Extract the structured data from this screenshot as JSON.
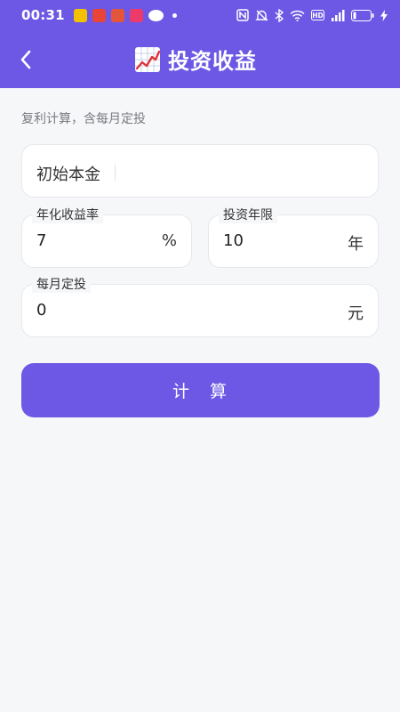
{
  "status_bar": {
    "time": "00:31",
    "app_icons": [
      "app-icon",
      "video-icon",
      "shop-icon",
      "music-icon",
      "wechat-icon"
    ],
    "indicators": [
      "nfc-icon",
      "mute-icon",
      "bluetooth-icon",
      "wifi-icon",
      "hd-icon",
      "signal-icon",
      "battery-icon",
      "charging-icon"
    ]
  },
  "header": {
    "back_icon": "chevron-left-icon",
    "title_icon": "chart-increasing-icon",
    "title": "投资收益"
  },
  "form": {
    "subtitle": "复利计算，含每月定投",
    "principal": {
      "placeholder": "初始本金"
    },
    "rate": {
      "label": "年化收益率",
      "value": "7",
      "suffix": "%"
    },
    "years": {
      "label": "投资年限",
      "value": "10",
      "suffix": "年"
    },
    "monthly": {
      "label": "每月定投",
      "value": "0",
      "suffix": "元"
    },
    "submit_label": "计　算"
  },
  "colors": {
    "accent": "#6c58e4",
    "background": "#f6f7f9",
    "card": "#ffffff"
  }
}
